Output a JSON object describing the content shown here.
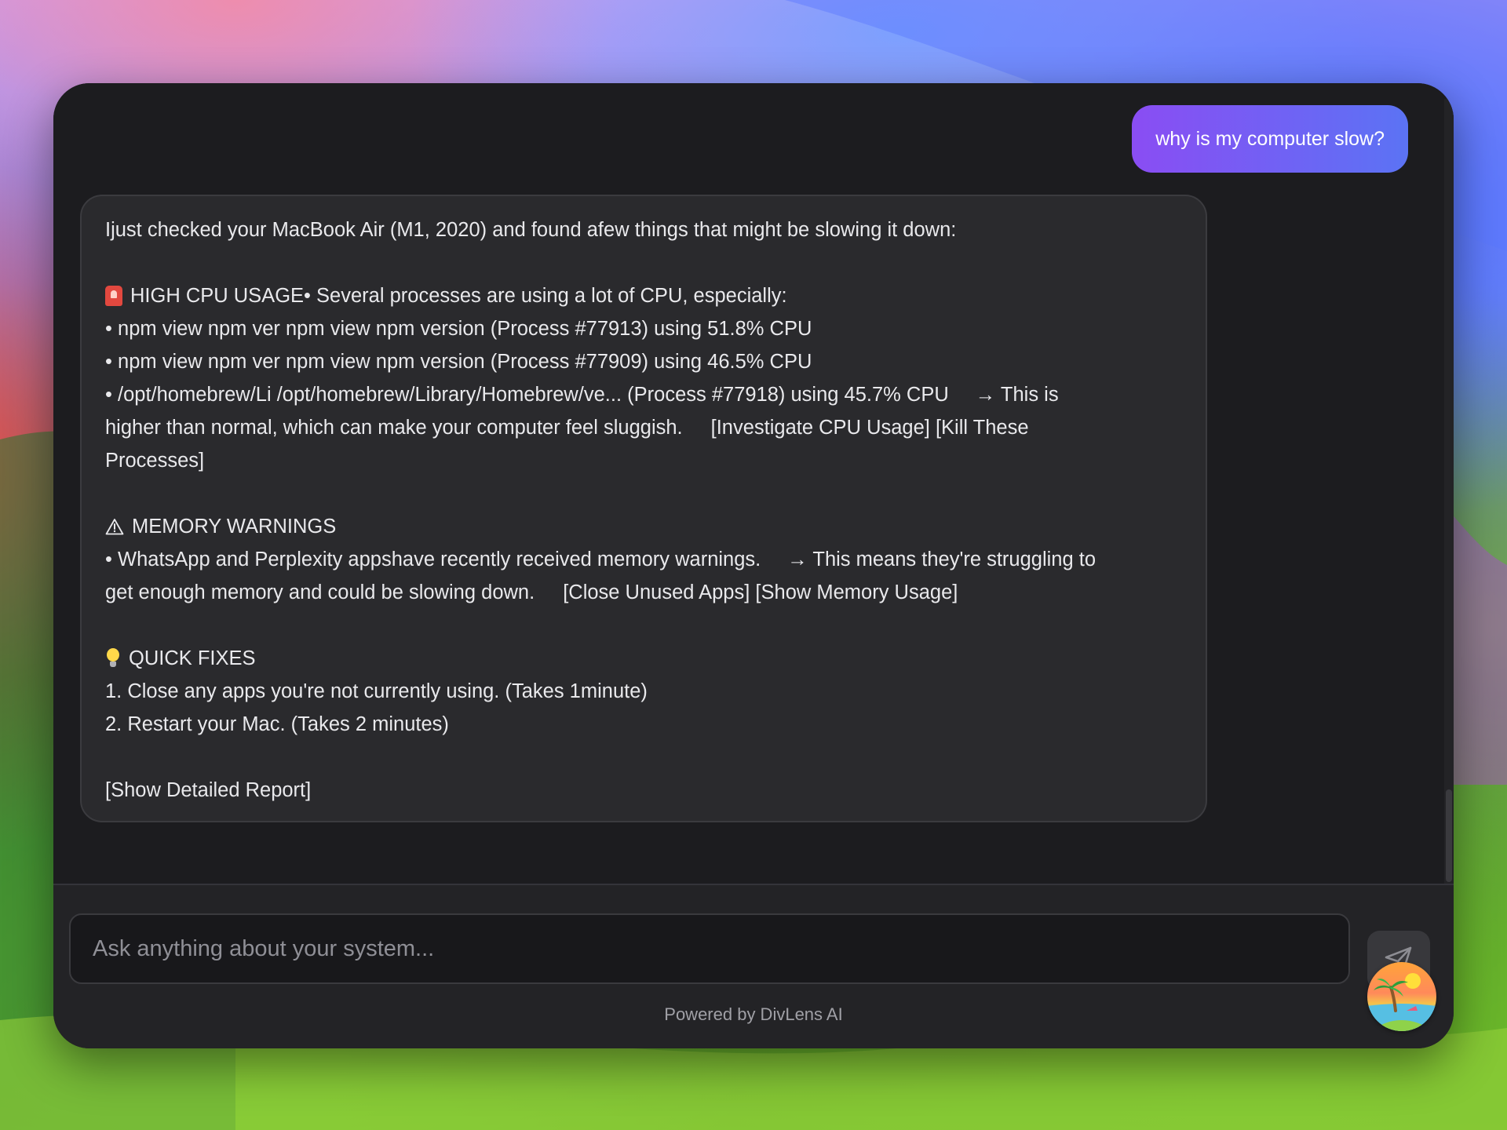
{
  "chat": {
    "user_message": "why is my computer slow?",
    "assistant_lines": [
      "Ijust checked your MacBook Air (M1, 2020) and found afew things that might be slowing it down:",
      "",
      "HIGH CPU USAGE• Several processes are using a lot of CPU, especially:",
      "• npm view npm ver npm view npm version (Process #77913) using 51.8% CPU",
      "• npm view npm ver npm view npm version (Process #77909) using 46.5% CPU",
      "• /opt/homebrew/Li /opt/homebrew/Library/Homebrew/ve... (Process #77918) using 45.7% CPU",
      "→ This is",
      "higher than normal, which can make your computer feel sluggish.",
      "[Investigate CPU Usage] [Kill These",
      "Processes]",
      "",
      "MEMORY WARNINGS",
      "• WhatsApp and Perplexity appshave recently received memory warnings.",
      "→ This means they're struggling to",
      "get enough memory and could be slowing down.",
      "[Close Unused Apps] [Show Memory Usage]",
      "",
      "QUICK FIXES",
      "1.  Close any apps you're not currently using. (Takes 1minute)",
      "2.  Restart your Mac. (Takes 2 minutes)",
      "",
      "[Show Detailed Report]"
    ]
  },
  "composer": {
    "placeholder": "Ask anything about your system...",
    "send_icon": "paper-plane-icon",
    "footer": "Powered by DivLens AI"
  },
  "icons": {
    "cpu": "siren-icon",
    "memory": "warning-icon",
    "fixes": "lightbulb-icon",
    "avatar": "island-avatar-icon"
  },
  "colors": {
    "window_bg": "#1c1c1f",
    "bubble_bg": "#2a2a2d",
    "user_bubble_start": "#8a4df3",
    "user_bubble_end": "#5b73f4"
  }
}
